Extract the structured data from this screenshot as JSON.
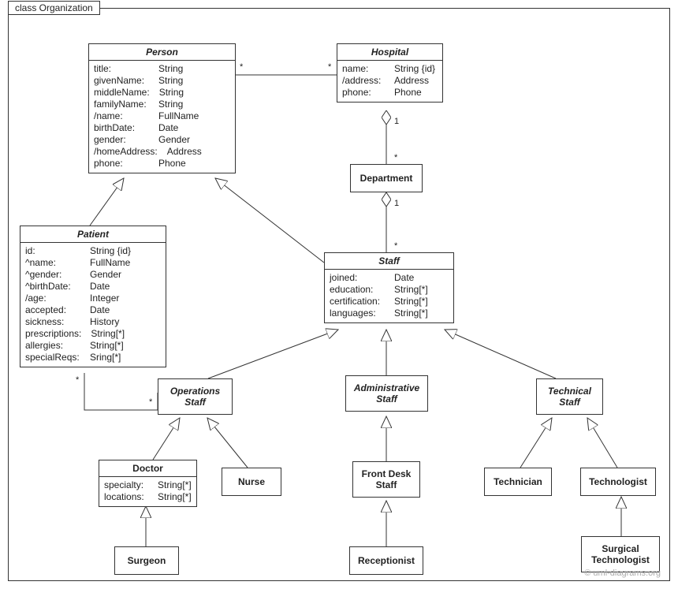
{
  "frameTitle": "class Organization",
  "watermark": "© uml-diagrams.org",
  "classes": {
    "person": {
      "name": "Person",
      "attrs": [
        {
          "n": "title:",
          "t": "String"
        },
        {
          "n": "givenName:",
          "t": "String"
        },
        {
          "n": "middleName:",
          "t": "String"
        },
        {
          "n": "familyName:",
          "t": "String"
        },
        {
          "n": "/name:",
          "t": "FullName"
        },
        {
          "n": "birthDate:",
          "t": "Date"
        },
        {
          "n": "gender:",
          "t": "Gender"
        },
        {
          "n": "/homeAddress:",
          "t": "Address"
        },
        {
          "n": "phone:",
          "t": "Phone"
        }
      ]
    },
    "hospital": {
      "name": "Hospital",
      "attrs": [
        {
          "n": "name:",
          "t": "String {id}"
        },
        {
          "n": "/address:",
          "t": "Address"
        },
        {
          "n": "phone:",
          "t": "Phone"
        }
      ]
    },
    "department": {
      "name": "Department"
    },
    "patient": {
      "name": "Patient",
      "attrs": [
        {
          "n": "id:",
          "t": "String {id}"
        },
        {
          "n": "^name:",
          "t": "FullName"
        },
        {
          "n": "^gender:",
          "t": "Gender"
        },
        {
          "n": "^birthDate:",
          "t": "Date"
        },
        {
          "n": "/age:",
          "t": "Integer"
        },
        {
          "n": "accepted:",
          "t": "Date"
        },
        {
          "n": "sickness:",
          "t": "History"
        },
        {
          "n": "prescriptions:",
          "t": "String[*]"
        },
        {
          "n": "allergies:",
          "t": "String[*]"
        },
        {
          "n": "specialReqs:",
          "t": "Sring[*]"
        }
      ]
    },
    "staff": {
      "name": "Staff",
      "attrs": [
        {
          "n": "joined:",
          "t": "Date"
        },
        {
          "n": "education:",
          "t": "String[*]"
        },
        {
          "n": "certification:",
          "t": "String[*]"
        },
        {
          "n": "languages:",
          "t": "String[*]"
        }
      ]
    },
    "opsStaff": {
      "name": "Operations",
      "name2": "Staff"
    },
    "adminStaff": {
      "name": "Administrative",
      "name2": "Staff"
    },
    "techStaff": {
      "name": "Technical",
      "name2": "Staff"
    },
    "doctor": {
      "name": "Doctor",
      "attrs": [
        {
          "n": "specialty:",
          "t": "String[*]"
        },
        {
          "n": "locations:",
          "t": "String[*]"
        }
      ]
    },
    "nurse": {
      "name": "Nurse"
    },
    "frontDesk": {
      "name": "Front Desk",
      "name2": "Staff"
    },
    "technician": {
      "name": "Technician"
    },
    "technologist": {
      "name": "Technologist"
    },
    "surgeon": {
      "name": "Surgeon"
    },
    "receptionist": {
      "name": "Receptionist"
    },
    "surgTech": {
      "name": "Surgical",
      "name2": "Technologist"
    }
  },
  "mult": {
    "star": "*",
    "one": "1"
  }
}
